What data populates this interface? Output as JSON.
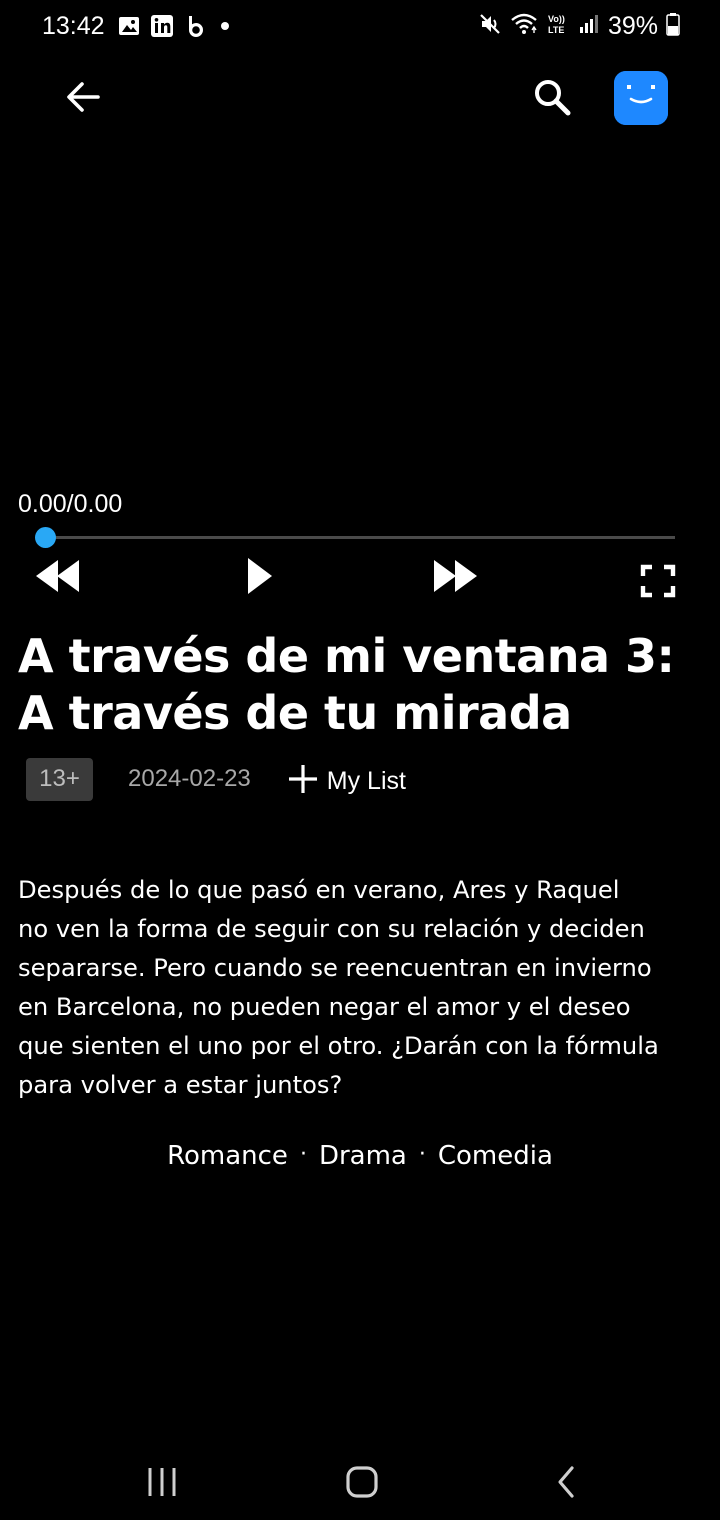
{
  "status_bar": {
    "time": "13:42",
    "battery": "39%",
    "left_icons": [
      "gallery-icon",
      "linkedin-icon",
      "beeper-icon",
      "notification-dot-icon"
    ],
    "right_icons": [
      "mute-icon",
      "wifi-icon",
      "volte-icon",
      "signal-icon",
      "battery-icon"
    ]
  },
  "top_bar": {
    "back_icon": "arrow-left-icon",
    "search_icon": "search-icon",
    "avatar_icon": "smiley-avatar-icon",
    "accent_color": "#1e88ff"
  },
  "player": {
    "time_readout": "0.00/0.00",
    "progress": 0,
    "thumb_color": "#29a8f5",
    "controls": [
      "rewind-icon",
      "play-icon",
      "fast-forward-icon",
      "fullscreen-icon"
    ]
  },
  "movie": {
    "title": "A través de mi ventana 3: A través de tu mirada",
    "rating": "13+",
    "release_date": "2024-02-23",
    "my_list_label": "My List",
    "description_lines": [
      "Después de lo que pasó en verano, Ares y Raquel",
      "no ven la forma de seguir con su relación y deciden",
      "separarse. Pero cuando se reencuentran en invierno",
      "en Barcelona, no pueden negar el amor y el deseo",
      "que sienten el uno por el otro. ¿Darán con la fórmula",
      "para volver a estar juntos?"
    ],
    "genres": [
      "Romance",
      "Drama",
      "Comedia"
    ],
    "genre_separator": "·"
  },
  "nav_bar": {
    "icons": [
      "recent-apps-icon",
      "home-icon",
      "back-icon"
    ]
  }
}
